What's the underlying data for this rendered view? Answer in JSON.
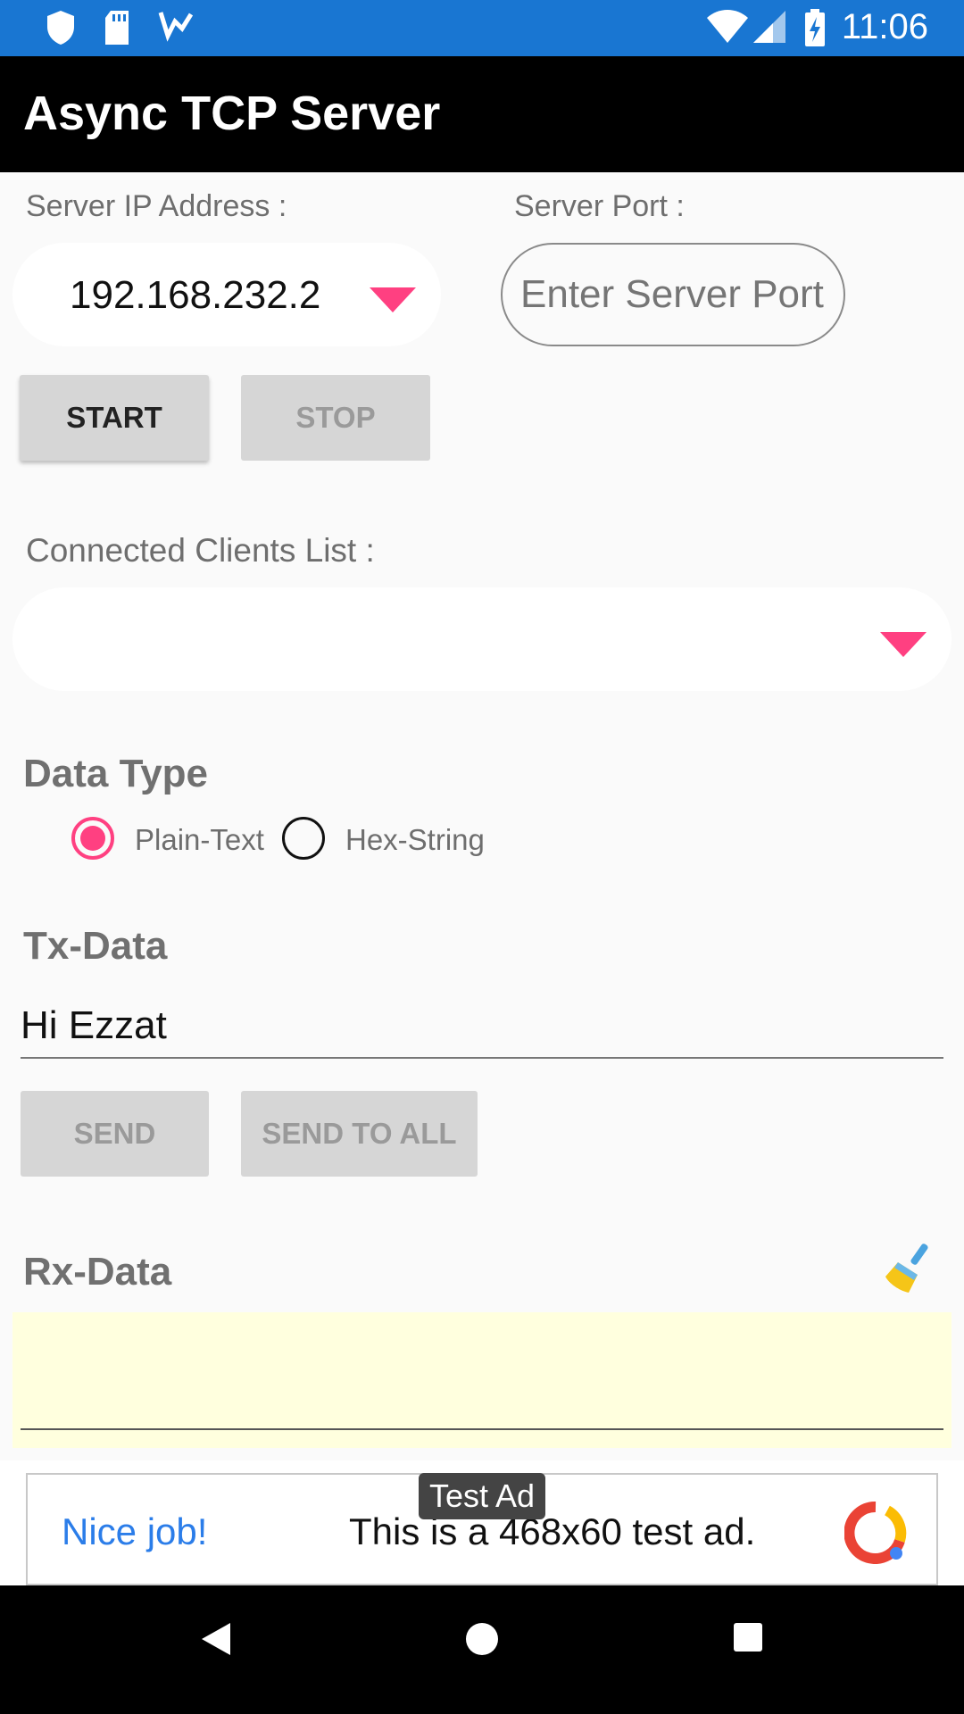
{
  "status_bar": {
    "time": "11:06"
  },
  "app_bar": {
    "title": "Async TCP Server"
  },
  "server": {
    "ip_label": "Server IP Address :",
    "ip_value": "192.168.232.2",
    "port_label": "Server Port :",
    "port_placeholder": "Enter Server Port"
  },
  "buttons": {
    "start": "START",
    "stop": "STOP",
    "send": "SEND",
    "send_all": "SEND TO ALL"
  },
  "clients": {
    "label": "Connected Clients List :"
  },
  "data_type": {
    "title": "Data Type",
    "options": [
      "Plain-Text",
      "Hex-String"
    ],
    "selected": "Plain-Text"
  },
  "tx": {
    "title": "Tx-Data",
    "value": "Hi Ezzat"
  },
  "rx": {
    "title": "Rx-Data"
  },
  "ad": {
    "badge": "Test Ad",
    "headline": "Nice job!",
    "text": "This is a 468x60 test ad."
  },
  "colors": {
    "status_bar": "#1976d2",
    "accent": "#ff4081",
    "rx_bg": "#ffffde"
  }
}
